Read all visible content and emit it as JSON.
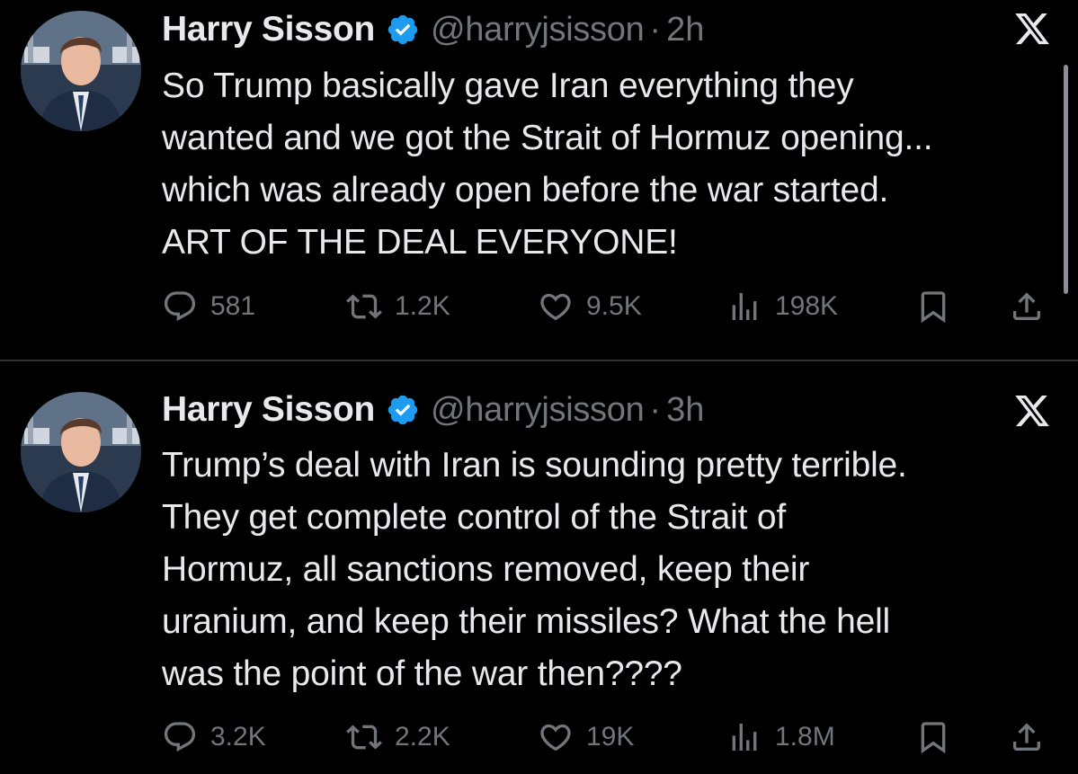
{
  "tweets": [
    {
      "display_name": "Harry Sisson",
      "handle": "@harryjsisson",
      "separator": "·",
      "time": "2h",
      "text": "So Trump basically gave Iran everything they\nwanted and we got the Strait of Hormuz opening...\nwhich was already open before the war started.\nART OF THE DEAL EVERYONE!",
      "replies": "581",
      "reposts": "1.2K",
      "likes": "9.5K",
      "views": "198K"
    },
    {
      "display_name": "Harry Sisson",
      "handle": "@harryjsisson",
      "separator": "·",
      "time": "3h",
      "text": "Trump’s deal with Iran is sounding pretty terrible.\nThey get complete control of the Strait of\nHormuz, all sanctions removed, keep their\nuranium, and keep their missiles? What the hell\nwas the point of the war then????",
      "replies": "3.2K",
      "reposts": "2.2K",
      "likes": "19K",
      "views": "1.8M"
    }
  ],
  "icons": {
    "verified": "verified-badge-icon",
    "reply": "reply-icon",
    "repost": "repost-icon",
    "like": "heart-icon",
    "views": "views-icon",
    "bookmark": "bookmark-icon",
    "share": "share-icon",
    "brand": "x-logo-icon"
  },
  "colors": {
    "background": "#000000",
    "text_primary": "#e7e9ea",
    "text_secondary": "#71767b",
    "verified": "#1d9bf0",
    "divider": "#2f3336"
  }
}
